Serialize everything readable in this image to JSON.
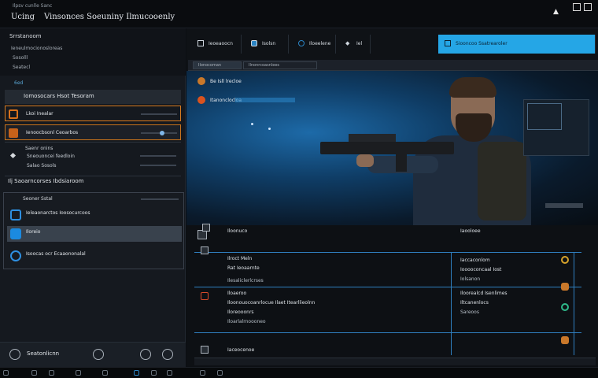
{
  "window": {
    "subtitle": "Ilpsv cunlle Sanc",
    "title_left": "Ucing",
    "title_main": "Vinsonces Soeuniny Ilmucooenly",
    "up_icon": "triangle-up-icon"
  },
  "sidebar": {
    "header": [
      "Srrstanoom",
      "Ieneulmocionosloreas",
      "Sosolll",
      "Seatecl"
    ],
    "count": "6ed",
    "section_title": "Iomosocars Hsot Tesoram",
    "rows": [
      {
        "label": "Lkoi Inealar",
        "icon_color": "#d9721c"
      },
      {
        "label": "Ienoocbsonl Ceoarbos",
        "icon_color": "#c6621a"
      }
    ],
    "group": [
      "Saenr onins",
      "Sneouoncei feedloin",
      "Salao Sosols"
    ],
    "license": "Ilj Saoarncorses Ibdsiaroom",
    "panel": {
      "head": "Seoner Sstal",
      "items": [
        {
          "label": "Ieleaonarctos Ioosocurcoos"
        },
        {
          "label": "Iloreio"
        },
        {
          "label": "Isoocas ocr Ecaaononalal"
        }
      ]
    },
    "bottom": {
      "label": "Seatonlicnn"
    }
  },
  "tabs": [
    {
      "label": "Ieoeaoocn",
      "active": false
    },
    {
      "label": "Isolsn",
      "active": false
    },
    {
      "label": "Iloeelene",
      "active": false
    },
    {
      "label": "Iel",
      "active": false
    },
    {
      "label": "Siooncoo Ssatrearoler",
      "active": true
    }
  ],
  "subtabs": [
    "Ilonocoman",
    "Ilnonrcoasnlees"
  ],
  "hero": {
    "lines": [
      "Be Isll lrecloe",
      "Itanonclocloa"
    ]
  },
  "table": {
    "header_left": "Iloonuco",
    "header_right": "Iaooloee",
    "rows": [
      {
        "left": [
          "Ilroct Meln",
          "Rat Ieoaarnte",
          "Ilesaliclerlcrses"
        ],
        "right": [
          "Iaccaconlom",
          "Iooooconcaal Iost",
          "Iolsanon"
        ],
        "icon": "ring-icon"
      },
      {
        "left": [
          "Iloaeroo",
          "Iloonouocoanrlocue Ilaet Itearllieolnn",
          "Iloreooonrs",
          "Iloarlalrnoooneo"
        ],
        "right": [
          "Iloorealcd Isenlimes",
          "Iltcanenlocs",
          "Sareoos"
        ],
        "icon": "teal-icon"
      },
      {
        "left": [
          "Iaceocenoe"
        ],
        "right": [],
        "icon": "orange-icon"
      }
    ]
  },
  "colors": {
    "accent": "#25a6e6",
    "highlight": "#d97b1f",
    "table_line": "#2f7fbf"
  }
}
